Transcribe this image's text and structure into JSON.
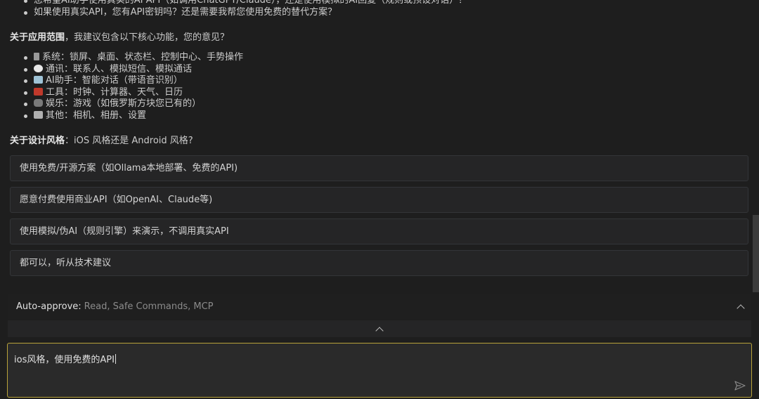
{
  "chat": {
    "top_list": [
      "您希望AI助手使用真实的AI API（如调用ChatGPT/Claude），还是使用模拟的AI回复（规则或预设对话）？",
      "如果使用真实API，您有API密钥吗？还是需要我帮您使用免费的替代方案？"
    ],
    "scope_heading_bold": "关于应用范围",
    "scope_heading_rest": "，我建议包含以下核心功能，您的意见？",
    "features": [
      {
        "icon": "phone-icon",
        "color": "#9a9a9a",
        "text": "系统：锁屏、桌面、状态栏、控制中心、手势操作"
      },
      {
        "icon": "speech-bubble-icon",
        "color": "#e8e8e8",
        "text": "通讯：联系人、模拟短信、模拟通话"
      },
      {
        "icon": "robot-icon",
        "color": "#9fc3d6",
        "text": "AI助手：智能对话（带语音识别）"
      },
      {
        "icon": "calendar-icon",
        "color": "#c0392b",
        "text": "工具：时钟、计算器、天气、日历"
      },
      {
        "icon": "gamepad-icon",
        "color": "#7a7a7a",
        "text": "娱乐：游戏（如俄罗斯方块您已有的）"
      },
      {
        "icon": "camera-icon",
        "color": "#b0b0b0",
        "text": "其他：相机、相册、设置"
      }
    ],
    "style_heading_bold": "关于设计风格",
    "style_heading_rest": "：iOS 风格还是 Android 风格?",
    "options": [
      "使用免费/开源方案（如Ollama本地部署、免费的API)",
      "愿意付费使用商业API（如OpenAI、Claude等)",
      "使用模拟/伪AI（规则引擎）来演示，不调用真实API",
      "都可以，听从技术建议"
    ]
  },
  "auto_approve": {
    "label": "Auto-approve:",
    "value": "Read, Safe Commands, MCP"
  },
  "input": {
    "value": "ios风格，使用免费的API"
  },
  "colors": {
    "background": "#1e1e1e",
    "input_border": "#b9a33a"
  }
}
